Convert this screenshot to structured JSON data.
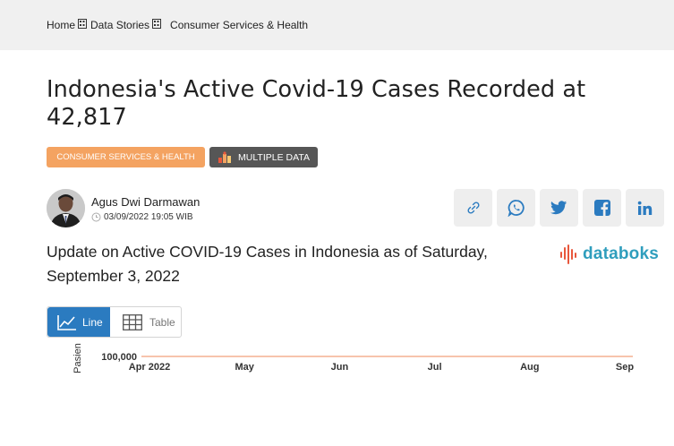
{
  "breadcrumb": {
    "home": "Home",
    "data_stories": "Data Stories",
    "current": "Consumer Services & Health"
  },
  "article": {
    "title": "Indonesia's Active Covid-19 Cases Recorded at 42,817",
    "category_tag": "CONSUMER SERVICES & HEALTH",
    "data_tag": "MULTIPLE DATA",
    "author": "Agus Dwi Darmawan",
    "date": "03/09/2022 19:05 WIB",
    "subtitle": "Update on Active COVID-19 Cases in Indonesia as of Saturday, September 3, 2022"
  },
  "share": {
    "icons": [
      "link-icon",
      "whatsapp-icon",
      "twitter-icon",
      "facebook-icon",
      "linkedin-icon"
    ]
  },
  "brand": {
    "logo_text": "databoks",
    "logo_color": "#2f9ebd",
    "logo_bars_color": "#e8573c"
  },
  "view_toggle": {
    "line_label": "Line",
    "table_label": "Table",
    "active": "Line",
    "active_color": "#2b7bc0"
  },
  "colors": {
    "category_tag": "#f4a361",
    "data_tag": "#565656",
    "topbar": "#f0f0f0"
  },
  "chart_data": {
    "type": "line",
    "ylabel": "Pasien",
    "yticks": [
      "100,000"
    ],
    "x_ticks": [
      "Apr 2022",
      "May",
      "Jun",
      "Jul",
      "Aug",
      "Sep"
    ],
    "gridline_color": "#f2a07c"
  }
}
